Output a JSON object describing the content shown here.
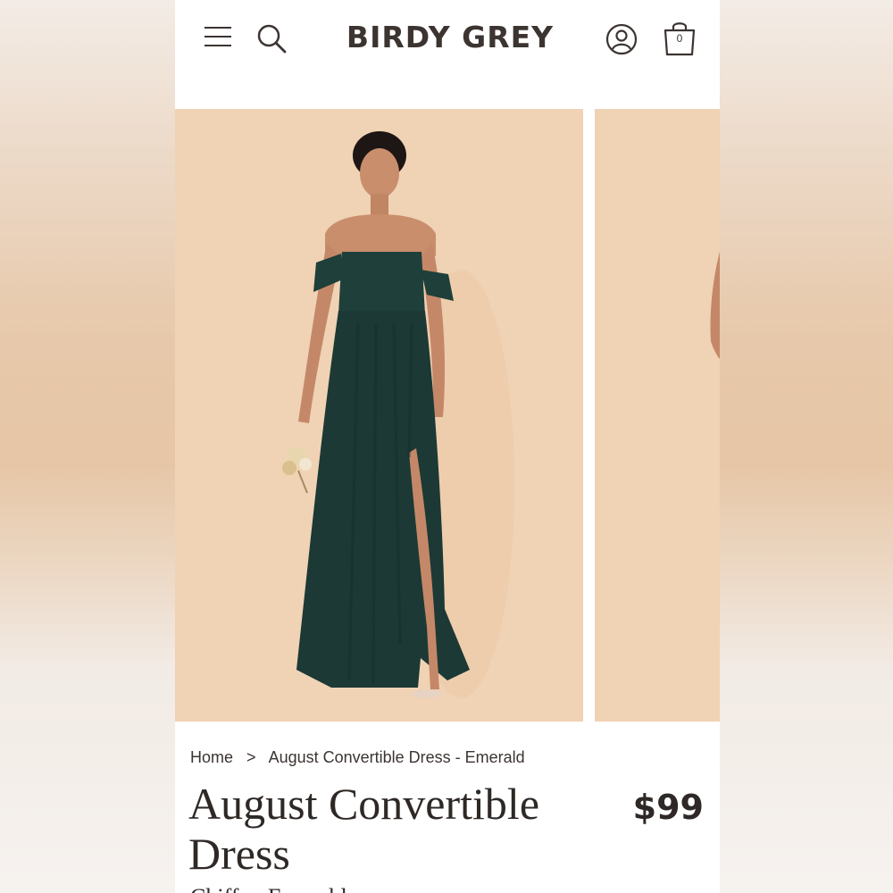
{
  "header": {
    "brand": "BIRDY GREY",
    "menu_icon": "hamburger-menu-icon",
    "search_icon": "search-icon",
    "account_icon": "account-icon",
    "bag_icon": "shopping-bag-icon",
    "bag_count": "0"
  },
  "gallery": {
    "background_color": "#f0d2b4",
    "dress_color": "#1f3f3a"
  },
  "breadcrumb": {
    "home": "Home",
    "separator": ">",
    "current": "August Convertible Dress - Emerald"
  },
  "product": {
    "title": "August Convertible Dress",
    "price": "$99",
    "subtitle": "Chiffon Emerald"
  }
}
